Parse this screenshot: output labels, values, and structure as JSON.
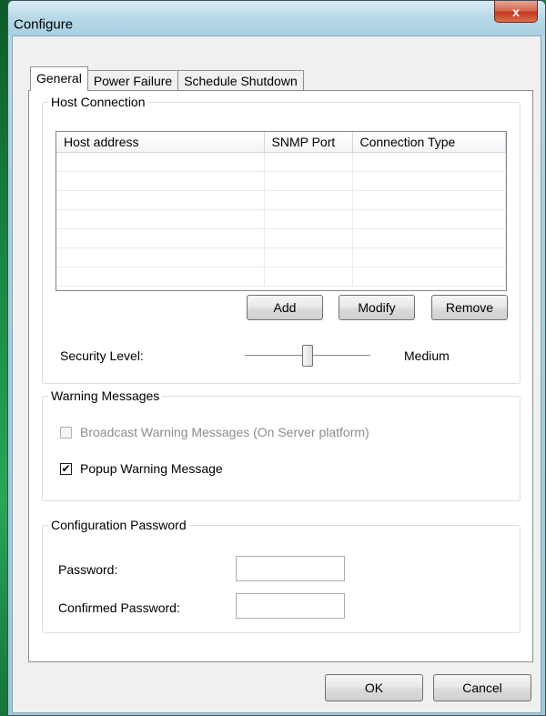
{
  "window": {
    "title": "Configure",
    "close_glyph": "x"
  },
  "tabs": [
    {
      "label": "General",
      "active": true
    },
    {
      "label": "Power Failure",
      "active": false
    },
    {
      "label": "Schedule Shutdown",
      "active": false
    }
  ],
  "host_connection": {
    "legend": "Host Connection",
    "columns": [
      "Host address",
      "SNMP Port",
      "Connection Type"
    ],
    "rows": [],
    "buttons": {
      "add": "Add",
      "modify": "Modify",
      "remove": "Remove"
    },
    "security_label": "Security Level:",
    "security_value": "Medium",
    "security_level_fraction": 0.5
  },
  "warning_messages": {
    "legend": "Warning Messages",
    "broadcast": {
      "label": "Broadcast Warning Messages (On Server platform)",
      "checked": false,
      "enabled": false
    },
    "popup": {
      "label": "Popup Warning Message",
      "checked": true,
      "enabled": true
    }
  },
  "config_password": {
    "legend": "Configuration Password",
    "password_label": "Password:",
    "password_value": "",
    "confirm_label": "Confirmed Password:",
    "confirm_value": ""
  },
  "dialog_buttons": {
    "ok": "OK",
    "cancel": "Cancel"
  },
  "colors": {
    "titlebar": "#b7d9e8",
    "close_button": "#c3371c",
    "panel": "#ffffff",
    "desktop": "#1e7a3c"
  }
}
